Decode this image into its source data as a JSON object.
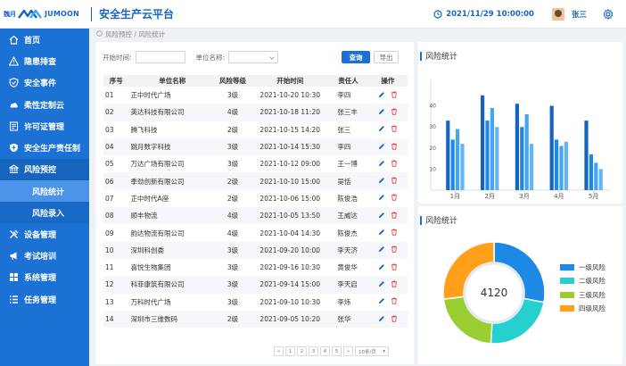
{
  "header": {
    "logo_cn": "魏月",
    "logo_en": "JUMOON",
    "app_title": "安全生产云平台",
    "datetime": "2021/11/29  10:00:00",
    "username": "张三"
  },
  "sidebar": {
    "items": [
      {
        "label": "首页",
        "icon": "home-icon"
      },
      {
        "label": "隐患排查",
        "icon": "warning-icon"
      },
      {
        "label": "安全事件",
        "icon": "shield-icon"
      },
      {
        "label": "柔性定制云",
        "icon": "cloud-icon"
      },
      {
        "label": "许可证管理",
        "icon": "license-icon"
      },
      {
        "label": "安全生产责任制",
        "icon": "badge-shield-icon"
      },
      {
        "label": "风险预控",
        "icon": "bank-icon"
      },
      {
        "label": "风险统计",
        "icon": ""
      },
      {
        "label": "风险录入",
        "icon": ""
      },
      {
        "label": "设备管理",
        "icon": "tools-icon"
      },
      {
        "label": "考试培训",
        "icon": "megaphone-icon"
      },
      {
        "label": "系统管理",
        "icon": "grid-icon"
      },
      {
        "label": "任务管理",
        "icon": "list-icon"
      }
    ],
    "active": "风险统计"
  },
  "breadcrumb": "风险预控 / 风险统计",
  "filter": {
    "start_label": "开始时间:",
    "start_value": "",
    "unit_label": "单位名称:",
    "unit_value": "",
    "query_label": "查询",
    "export_label": "导出"
  },
  "table": {
    "headers": [
      "序号",
      "单位名称",
      "风险等级",
      "开始时间",
      "责任人",
      "操作"
    ],
    "rows": [
      {
        "no": "01",
        "name": "正中时代广场",
        "level": "3级",
        "time": "2021-10-20  10:30",
        "user": "李四"
      },
      {
        "no": "02",
        "name": "英达科技有限公司",
        "level": "4级",
        "time": "2021-10-18  11:20",
        "user": "张三丰"
      },
      {
        "no": "03",
        "name": "腾飞科技",
        "level": "2级",
        "time": "2021-10-15  14:20",
        "user": "张三"
      },
      {
        "no": "04",
        "name": "跳月数字科技",
        "level": "3级",
        "time": "2021-10-14  15:30",
        "user": "李四"
      },
      {
        "no": "05",
        "name": "万达广场有限公司",
        "level": "3级",
        "time": "2021-10-12  09:00",
        "user": "王一博"
      },
      {
        "no": "06",
        "name": "季劲创新有限公司",
        "level": "2级",
        "time": "2021-10-10  15:00",
        "user": "吴恬"
      },
      {
        "no": "07",
        "name": "正中时代A座",
        "level": "2级",
        "time": "2021-10-06  15:00",
        "user": "陈俊浩"
      },
      {
        "no": "08",
        "name": "顺丰物流",
        "level": "4级",
        "time": "2021-10-05  13:50",
        "user": "王威达"
      },
      {
        "no": "09",
        "name": "韵达物流有限公司",
        "level": "4级",
        "time": "2021-10-04  14:30",
        "user": "陈俊杰"
      },
      {
        "no": "10",
        "name": "深圳科创委",
        "level": "3级",
        "time": "2021-09-20  10:00",
        "user": "李天济"
      },
      {
        "no": "11",
        "name": "喜悦生物集团",
        "level": "3级",
        "time": "2021-09-16  10:30",
        "user": "黄俊华"
      },
      {
        "no": "12",
        "name": "科菲康筑有限公司",
        "level": "3级",
        "time": "2021-09-14  15:00",
        "user": "李天启"
      },
      {
        "no": "13",
        "name": "万科时代广场",
        "level": "3级",
        "time": "2021-09-10  10:30",
        "user": "李炜"
      },
      {
        "no": "14",
        "name": "深圳市三维数码",
        "level": "2级",
        "time": "2021-09-05  10:20",
        "user": "张华"
      }
    ]
  },
  "pagination": {
    "prev": "«",
    "pages": [
      "1",
      "2",
      "3",
      "4",
      "5"
    ],
    "next": "»",
    "page_size": "10条/页"
  },
  "bar_card": {
    "title": "风险统计",
    "chart_data": {
      "type": "bar",
      "categories": [
        "1月",
        "2月",
        "3月",
        "4月",
        "5月"
      ],
      "series": [
        {
          "color": "#1565c0",
          "values": [
            33,
            45,
            41,
            40,
            33
          ]
        },
        {
          "color": "#1e88e5",
          "values": [
            24,
            33,
            30,
            24,
            17
          ]
        },
        {
          "color": "#42a5f5",
          "values": [
            29,
            39,
            36,
            21,
            13
          ]
        },
        {
          "color": "#64b5f6",
          "values": [
            22,
            30,
            22,
            23,
            10
          ]
        }
      ],
      "yticks": [
        10,
        20,
        30,
        40
      ],
      "ylim": [
        0,
        50
      ]
    }
  },
  "donut_card": {
    "title": "风险统计",
    "total": "4120",
    "chart_data": {
      "type": "pie",
      "slices": [
        {
          "label": "一级风险",
          "value": 28,
          "color": "#1e88e5"
        },
        {
          "label": "二级风险",
          "value": 23,
          "color": "#26d0ce"
        },
        {
          "label": "三级风险",
          "value": 22,
          "color": "#9acd32"
        },
        {
          "label": "四级风险",
          "value": 27,
          "color": "#ff9f1a"
        }
      ]
    }
  }
}
